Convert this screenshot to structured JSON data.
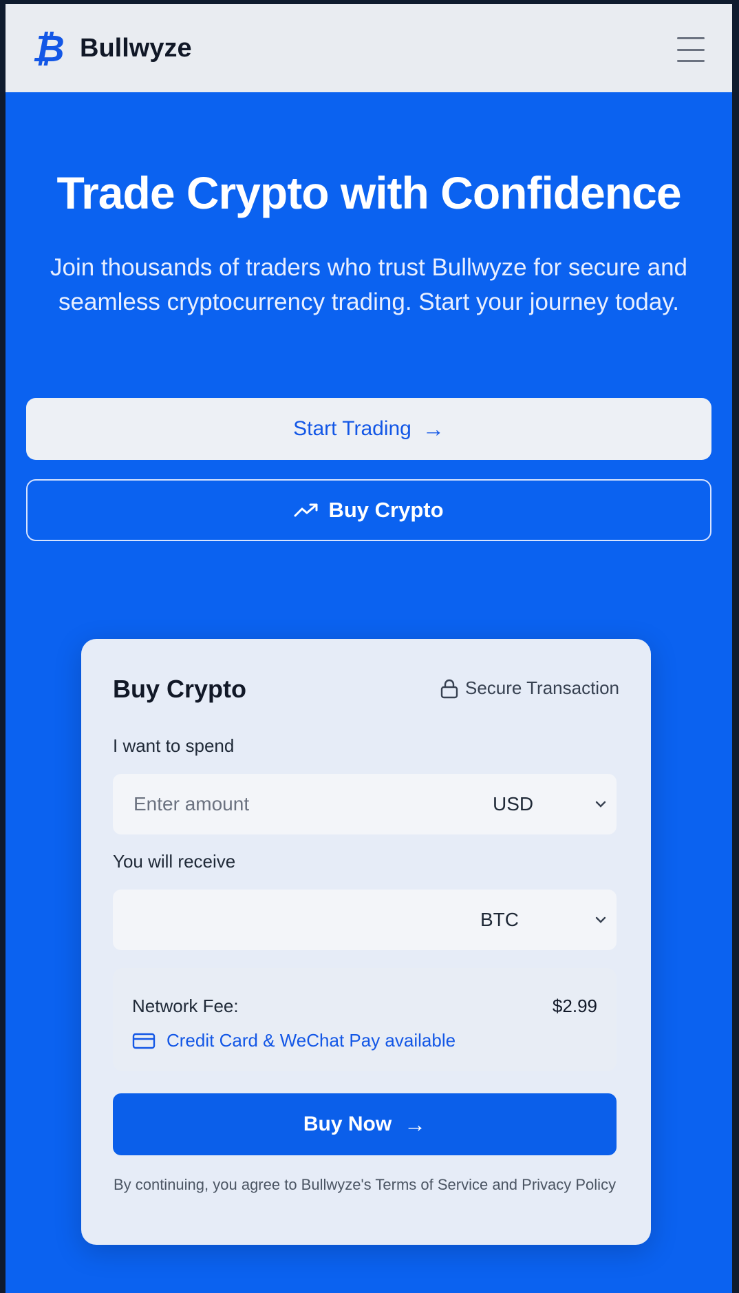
{
  "header": {
    "brand": "Bullwyze",
    "logo_glyph": "₿",
    "menu_icon": "hamburger-icon"
  },
  "hero": {
    "title": "Trade Crypto with Confidence",
    "subtitle": "Join thousands of traders who trust Bullwyze for secure and seamless cryptocurrency trading. Start your journey today.",
    "start_trading_label": "Start Trading",
    "buy_crypto_label": "Buy Crypto"
  },
  "card": {
    "title": "Buy Crypto",
    "secure_label": "Secure Transaction",
    "spend_label": "I want to spend",
    "spend_placeholder": "Enter amount",
    "spend_currency": "USD",
    "receive_label": "You will receive",
    "receive_currency": "BTC",
    "fee_label": "Network Fee:",
    "fee_value": "$2.99",
    "payment_note": "Credit Card & WeChat Pay available",
    "buy_now_label": "Buy Now",
    "terms_text": "By continuing, you agree to Bullwyze's Terms of Service and Privacy Policy"
  },
  "colors": {
    "primary": "#0b62f0",
    "accent": "#1357e6",
    "header_bg": "#e9ecf1",
    "card_bg": "#e6ecf7"
  },
  "arrow_glyph": "→"
}
